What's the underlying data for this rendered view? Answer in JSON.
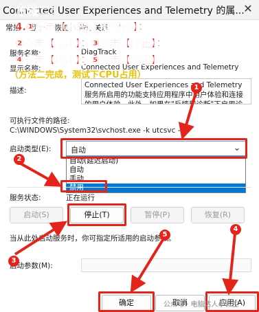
{
  "window": {
    "title": "Connected User Experiences and Telemetry 的属..."
  },
  "tabs": [
    "常规",
    "登录",
    "恢复",
    "依赖关系"
  ],
  "fields": {
    "service_name_label": "服务名称:",
    "service_name_value": "DiagTrack",
    "display_name_label": "显示名称:",
    "display_name_value": "Connected User Experiences and Telemetry",
    "description_label": "描述:",
    "description_value": "Connected User Experiences and Telemetry 服务所启用的功能支持应用程序中用户体验和连接的用户体验。此外，如果在\"反馈和诊断\"下启用诊断和使用情况隐私选项设置，",
    "exe_path_label": "可执行文件的路径:",
    "exe_path_value": "C:\\WINDOWS\\System32\\svchost.exe -k utcsvc -p",
    "startup_type_label": "启动类型(E):",
    "service_status_label": "服务状态:",
    "service_status_value": "正在运行",
    "start_params_note": "当从此处启动服务时，你可指定所适用的启动参数。",
    "start_params_label": "启动参数(M):"
  },
  "startup_select": {
    "selected": "自动",
    "options": [
      "自动(延迟启动)",
      "自动",
      "手动",
      "禁用"
    ],
    "highlighted_option": "禁用"
  },
  "service_buttons": {
    "start": "启动(S)",
    "stop": "停止(T)",
    "pause": "暂停(P)",
    "resume": "恢复(R)"
  },
  "footer_buttons": {
    "ok": "确定",
    "cancel": "取消",
    "apply": "应用(A)"
  },
  "overlay": {
    "method_title": "方法二：",
    "line1": "4.①点击【小三角（图标）】；",
    "line2": "②点击【禁用】；③点击【停止】；",
    "line3": "④点击【应用】；⑤点击【确定】",
    "line4": "（方法二完成，测试下CPU占用）",
    "badges": [
      "1",
      "2",
      "3",
      "4",
      "5"
    ],
    "watermark": "公众号 · 电脑达人小微生"
  },
  "colors": {
    "annotation_red": "#e4241b",
    "annotation_yellow": "#e8c20a",
    "selection_blue": "#0078d7"
  }
}
